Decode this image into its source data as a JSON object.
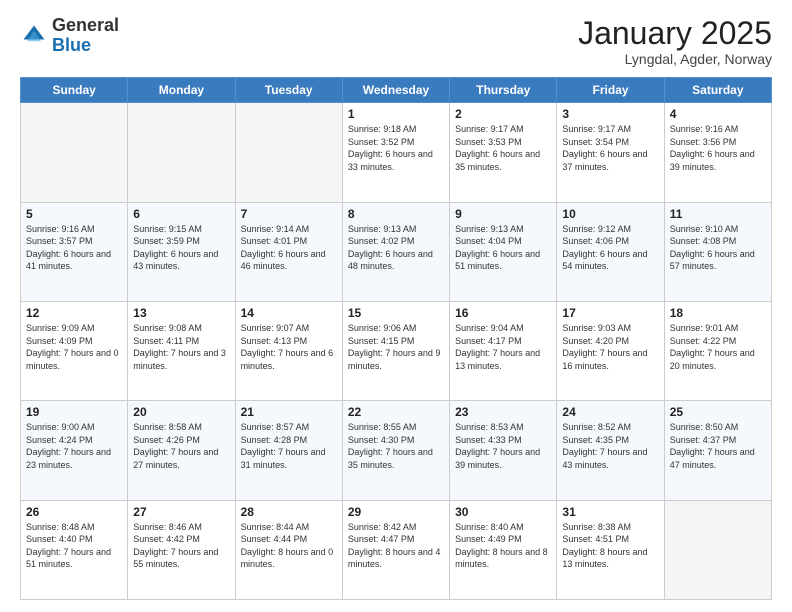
{
  "header": {
    "logo": {
      "line1": "General",
      "line2": "Blue"
    },
    "title": "January 2025",
    "subtitle": "Lyngdal, Agder, Norway"
  },
  "days_of_week": [
    "Sunday",
    "Monday",
    "Tuesday",
    "Wednesday",
    "Thursday",
    "Friday",
    "Saturday"
  ],
  "weeks": [
    [
      {
        "day": "",
        "info": ""
      },
      {
        "day": "",
        "info": ""
      },
      {
        "day": "",
        "info": ""
      },
      {
        "day": "1",
        "info": "Sunrise: 9:18 AM\nSunset: 3:52 PM\nDaylight: 6 hours and 33 minutes."
      },
      {
        "day": "2",
        "info": "Sunrise: 9:17 AM\nSunset: 3:53 PM\nDaylight: 6 hours and 35 minutes."
      },
      {
        "day": "3",
        "info": "Sunrise: 9:17 AM\nSunset: 3:54 PM\nDaylight: 6 hours and 37 minutes."
      },
      {
        "day": "4",
        "info": "Sunrise: 9:16 AM\nSunset: 3:56 PM\nDaylight: 6 hours and 39 minutes."
      }
    ],
    [
      {
        "day": "5",
        "info": "Sunrise: 9:16 AM\nSunset: 3:57 PM\nDaylight: 6 hours and 41 minutes."
      },
      {
        "day": "6",
        "info": "Sunrise: 9:15 AM\nSunset: 3:59 PM\nDaylight: 6 hours and 43 minutes."
      },
      {
        "day": "7",
        "info": "Sunrise: 9:14 AM\nSunset: 4:01 PM\nDaylight: 6 hours and 46 minutes."
      },
      {
        "day": "8",
        "info": "Sunrise: 9:13 AM\nSunset: 4:02 PM\nDaylight: 6 hours and 48 minutes."
      },
      {
        "day": "9",
        "info": "Sunrise: 9:13 AM\nSunset: 4:04 PM\nDaylight: 6 hours and 51 minutes."
      },
      {
        "day": "10",
        "info": "Sunrise: 9:12 AM\nSunset: 4:06 PM\nDaylight: 6 hours and 54 minutes."
      },
      {
        "day": "11",
        "info": "Sunrise: 9:10 AM\nSunset: 4:08 PM\nDaylight: 6 hours and 57 minutes."
      }
    ],
    [
      {
        "day": "12",
        "info": "Sunrise: 9:09 AM\nSunset: 4:09 PM\nDaylight: 7 hours and 0 minutes."
      },
      {
        "day": "13",
        "info": "Sunrise: 9:08 AM\nSunset: 4:11 PM\nDaylight: 7 hours and 3 minutes."
      },
      {
        "day": "14",
        "info": "Sunrise: 9:07 AM\nSunset: 4:13 PM\nDaylight: 7 hours and 6 minutes."
      },
      {
        "day": "15",
        "info": "Sunrise: 9:06 AM\nSunset: 4:15 PM\nDaylight: 7 hours and 9 minutes."
      },
      {
        "day": "16",
        "info": "Sunrise: 9:04 AM\nSunset: 4:17 PM\nDaylight: 7 hours and 13 minutes."
      },
      {
        "day": "17",
        "info": "Sunrise: 9:03 AM\nSunset: 4:20 PM\nDaylight: 7 hours and 16 minutes."
      },
      {
        "day": "18",
        "info": "Sunrise: 9:01 AM\nSunset: 4:22 PM\nDaylight: 7 hours and 20 minutes."
      }
    ],
    [
      {
        "day": "19",
        "info": "Sunrise: 9:00 AM\nSunset: 4:24 PM\nDaylight: 7 hours and 23 minutes."
      },
      {
        "day": "20",
        "info": "Sunrise: 8:58 AM\nSunset: 4:26 PM\nDaylight: 7 hours and 27 minutes."
      },
      {
        "day": "21",
        "info": "Sunrise: 8:57 AM\nSunset: 4:28 PM\nDaylight: 7 hours and 31 minutes."
      },
      {
        "day": "22",
        "info": "Sunrise: 8:55 AM\nSunset: 4:30 PM\nDaylight: 7 hours and 35 minutes."
      },
      {
        "day": "23",
        "info": "Sunrise: 8:53 AM\nSunset: 4:33 PM\nDaylight: 7 hours and 39 minutes."
      },
      {
        "day": "24",
        "info": "Sunrise: 8:52 AM\nSunset: 4:35 PM\nDaylight: 7 hours and 43 minutes."
      },
      {
        "day": "25",
        "info": "Sunrise: 8:50 AM\nSunset: 4:37 PM\nDaylight: 7 hours and 47 minutes."
      }
    ],
    [
      {
        "day": "26",
        "info": "Sunrise: 8:48 AM\nSunset: 4:40 PM\nDaylight: 7 hours and 51 minutes."
      },
      {
        "day": "27",
        "info": "Sunrise: 8:46 AM\nSunset: 4:42 PM\nDaylight: 7 hours and 55 minutes."
      },
      {
        "day": "28",
        "info": "Sunrise: 8:44 AM\nSunset: 4:44 PM\nDaylight: 8 hours and 0 minutes."
      },
      {
        "day": "29",
        "info": "Sunrise: 8:42 AM\nSunset: 4:47 PM\nDaylight: 8 hours and 4 minutes."
      },
      {
        "day": "30",
        "info": "Sunrise: 8:40 AM\nSunset: 4:49 PM\nDaylight: 8 hours and 8 minutes."
      },
      {
        "day": "31",
        "info": "Sunrise: 8:38 AM\nSunset: 4:51 PM\nDaylight: 8 hours and 13 minutes."
      },
      {
        "day": "",
        "info": ""
      }
    ]
  ]
}
